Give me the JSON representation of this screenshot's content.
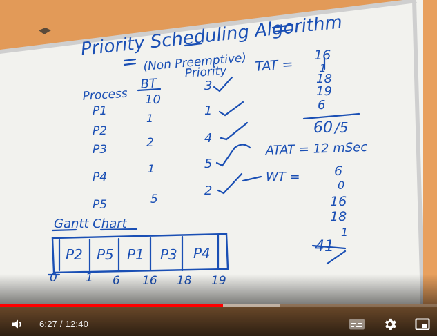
{
  "video": {
    "board": {
      "title": "Priority Scheduling Algorithm",
      "subtitle": "(Non Preemptive)",
      "headers": {
        "process": "Process",
        "bt": "BT",
        "priority": "Priority"
      },
      "rows": [
        {
          "process": "P1",
          "bt": "10",
          "priority": "3"
        },
        {
          "process": "P2",
          "bt": "1",
          "priority": "1"
        },
        {
          "process": "P3",
          "bt": "2",
          "priority": "4"
        },
        {
          "process": "P4",
          "bt": "1",
          "priority": "5"
        },
        {
          "process": "P5",
          "bt": "5",
          "priority": "2"
        }
      ],
      "tat_label": "TAT =",
      "tat_values": [
        "16",
        "1",
        "18",
        "19",
        "6"
      ],
      "tat_sum": "60",
      "tat_div": "/5",
      "atat": "ATAT = 12 mSec",
      "wt_label": "WT =",
      "wt_values": [
        "6",
        "0",
        "16",
        "18",
        "1"
      ],
      "wt_sum": "41",
      "gantt_label": "Gantt Chart",
      "gantt_cells": [
        "P2",
        "P5",
        "P1",
        "P3",
        "P4"
      ],
      "gantt_ticks": [
        "0",
        "1",
        "6",
        "16",
        "18",
        "19"
      ]
    }
  },
  "player": {
    "current_time": "6:27",
    "separator": " / ",
    "duration": "12:40",
    "played_fraction": 0.51,
    "buffered_fraction": 0.64,
    "accent_color": "#ff0000",
    "icons": {
      "volume": "volume-icon",
      "subtitles": "subtitles-icon",
      "settings": "settings-gear-icon",
      "miniplayer": "miniplayer-icon"
    }
  }
}
